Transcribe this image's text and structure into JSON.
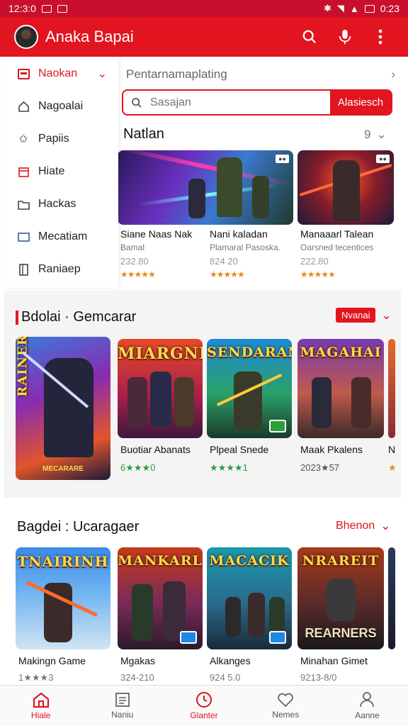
{
  "status_bar": {
    "time_left": "12:3:0",
    "time_right": "0:23"
  },
  "app_bar": {
    "title": "Anaka Bapai",
    "icons": [
      "search-icon",
      "mic-icon",
      "more-vert-icon"
    ]
  },
  "drawer": {
    "items": [
      {
        "label": "Naokan",
        "icon": "inbox-icon",
        "active": true
      },
      {
        "label": "Nagoalai",
        "icon": "home-icon"
      },
      {
        "label": "Papiis",
        "icon": "star-icon"
      },
      {
        "label": "Hiate",
        "icon": "calendar-icon"
      },
      {
        "label": "Hackas",
        "icon": "folder-icon"
      },
      {
        "label": "Mecatiam",
        "icon": "monitor-icon"
      },
      {
        "label": "Raniaep",
        "icon": "book-icon"
      }
    ]
  },
  "search": {
    "hint": "Pentarnamaplating",
    "placeholder": "Sasajan",
    "button_label": "Alasiesch"
  },
  "section1": {
    "title": "Natlan",
    "count": "9",
    "cards": [
      {
        "title": "Siane Naas Nak",
        "sub": "Bamal",
        "price": "232.80",
        "stars": "★★★★★"
      },
      {
        "title": "Nani kaladan",
        "sub": "Plamaral Pasoska.",
        "price": "824 20",
        "stars": "★★★★★"
      },
      {
        "title": "Manaaarl Talean",
        "sub": "Oarsned tecentices",
        "price": "222.80",
        "stars": "★★★★★"
      }
    ]
  },
  "section2": {
    "title": "Bdolai · Gemcarar",
    "pill": "Nvanai",
    "feature_logo": "RAINER",
    "feature_caption": "MECARARE",
    "cards": [
      {
        "logo": "MIARGNI",
        "title": "Buotiar Abanats",
        "stat": "6★★★0"
      },
      {
        "logo": "SENDARAN",
        "title": "Plpeal Snede",
        "stat": "★★★★1"
      },
      {
        "logo": "MAGAHAI",
        "title": "Maak Pkalens",
        "stat": "2023★57"
      },
      {
        "logo": "",
        "title": "N",
        "stat": "★"
      }
    ]
  },
  "section3": {
    "title": "Bagdei : Ucaragaer",
    "link": "Bhenon",
    "cards": [
      {
        "logo": "TNAIRINH",
        "title": "Makingn Game",
        "stat": "1★★★3"
      },
      {
        "logo": "MANKARL",
        "title": "Mgakas",
        "stat": "324-210"
      },
      {
        "logo": "MACACIK",
        "title": "Alkanges",
        "stat": "924 5.0"
      },
      {
        "logo": "NRAREIT",
        "caption": "REARNERS",
        "title": "Minahan Gimet",
        "stat": "9213-8/0"
      }
    ]
  },
  "bottom_nav": {
    "items": [
      {
        "label": "Hiale",
        "icon": "home-icon",
        "active": true
      },
      {
        "label": "Naniu",
        "icon": "list-icon"
      },
      {
        "label": "Glanter",
        "icon": "clock-icon"
      },
      {
        "label": "Nemes",
        "icon": "heart-icon"
      },
      {
        "label": "Aanne",
        "icon": "person-icon"
      }
    ]
  },
  "colors": {
    "primary": "#e2141f",
    "status": "#c8102e",
    "star": "#e8891b",
    "star_green": "#2e9e3a"
  }
}
